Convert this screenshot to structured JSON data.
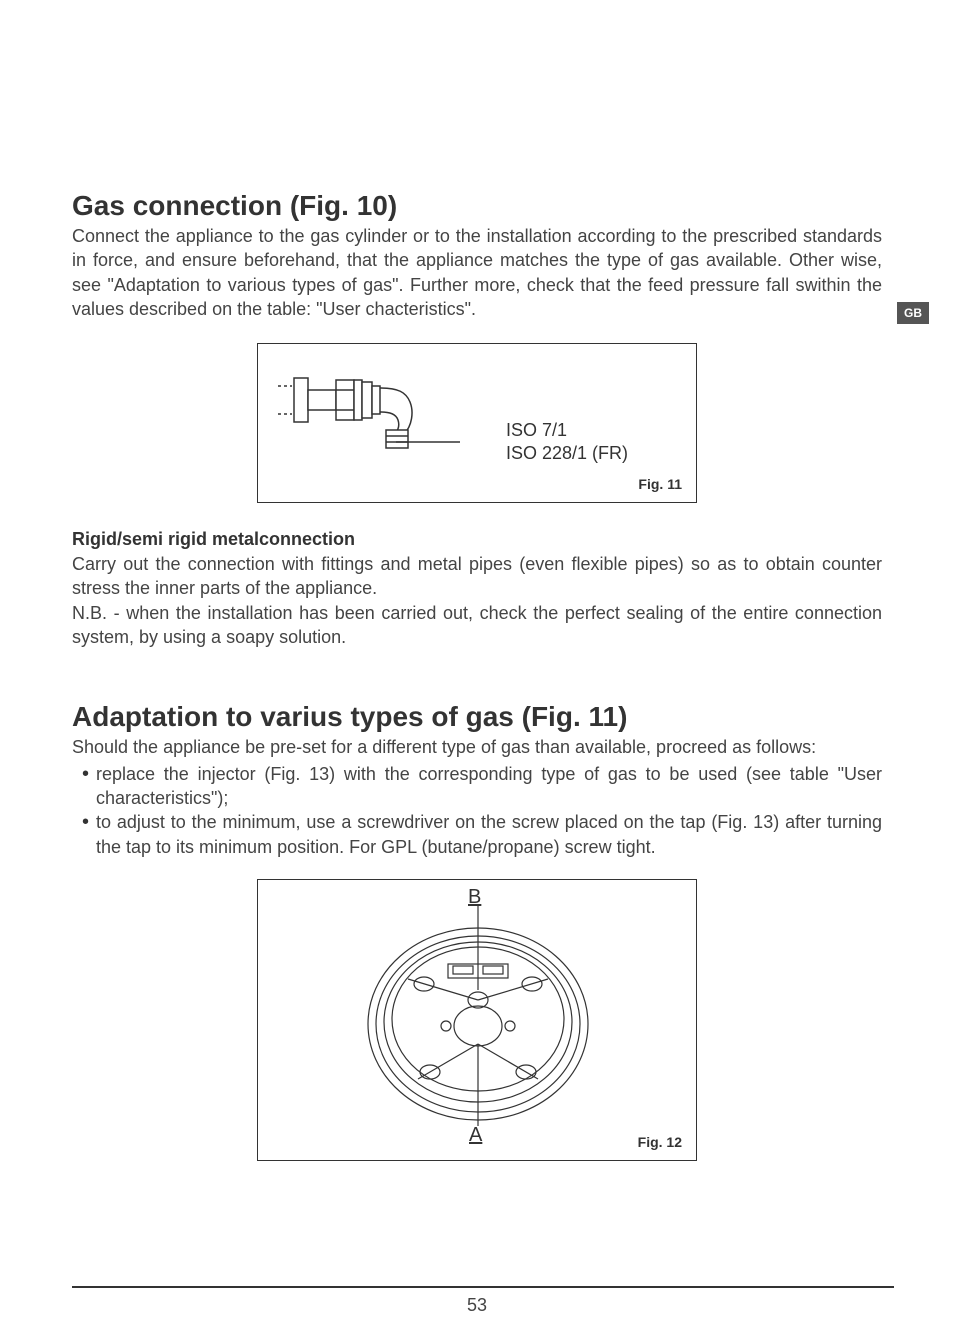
{
  "sideTab": "GB",
  "section1": {
    "heading": "Gas connection (Fig. 10)",
    "paragraph": "Connect the appliance to the gas cylinder or to the installation according to the prescribed standards in force, and ensure beforehand, that the appliance matches the type of gas available. Other wise, see \"Adaptation to various types of gas\". Further more, check that the feed pressure fall swithin the values described on the table: \"User chacteristics\"."
  },
  "figure11": {
    "label1": "ISO 7/1",
    "label2": "ISO 228/1 (FR)",
    "caption": "Fig. 11"
  },
  "section2": {
    "subheading": "Rigid/semi rigid metalconnection",
    "para1": "Carry out the connection with fittings and metal pipes (even flexible pipes) so as to obtain counter stress the inner parts of the appliance.",
    "para2": "N.B. - when the installation has been carried out, check the perfect sealing of the entire connection system, by using a soapy solution."
  },
  "section3": {
    "heading": "Adaptation to varius types of gas (Fig. 11)",
    "intro": "Should the appliance be pre-set for a different type of gas than available, procreed as follows:",
    "bullets": [
      "replace the injector (Fig. 13) with the corresponding  type of gas to be used (see table \"User characteristics\");",
      "to adjust to the minimum, use a screwdriver on the screw placed on the tap (Fig. 13) after turning the tap to its minimum position. For GPL (butane/propane) screw tight."
    ]
  },
  "figure12": {
    "labelB": "B",
    "labelA": "A",
    "caption": "Fig. 12"
  },
  "pageNumber": "53"
}
